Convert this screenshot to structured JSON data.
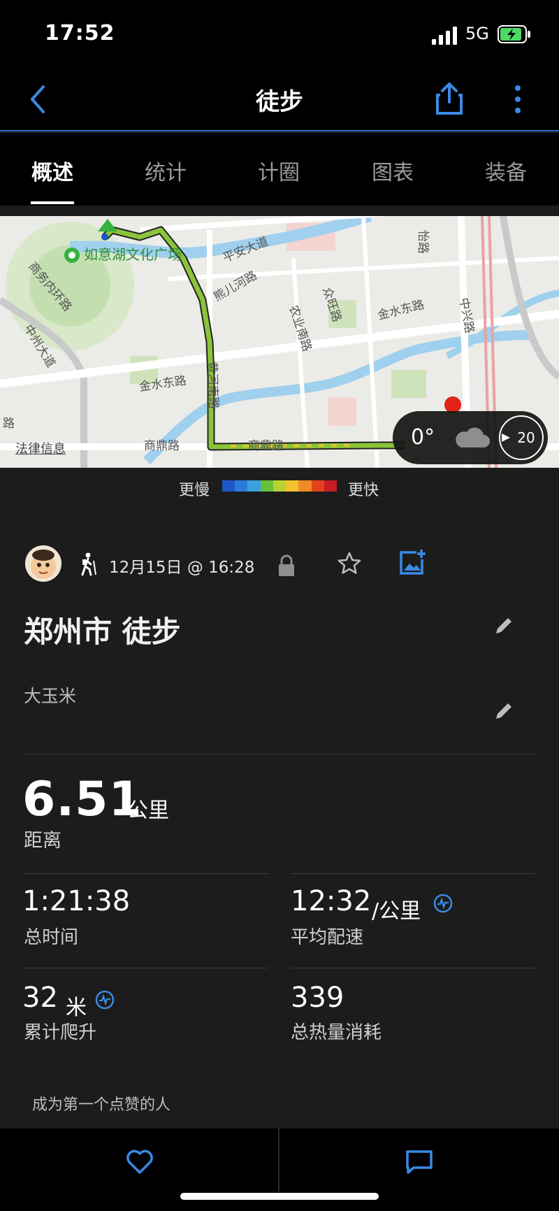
{
  "status": {
    "time": "17:52",
    "network": "5G",
    "battery_color": "#4cd964"
  },
  "nav": {
    "title": "徒步"
  },
  "tabs": [
    {
      "label": "概述",
      "active": true
    },
    {
      "label": "统计"
    },
    {
      "label": "计圈"
    },
    {
      "label": "图表"
    },
    {
      "label": "装备"
    }
  ],
  "map": {
    "legal": "法律信息",
    "labels": [
      "如意湖文化广场",
      "平安大道",
      "熊儿河路",
      "众旺路",
      "农业南路",
      "金水东路",
      "黄河南路",
      "商鼎路",
      "中州大道",
      "商务内环路",
      "中兴路",
      "金水东路",
      "怡路",
      "路",
      "商鼎路"
    ],
    "weather": {
      "temp": "0°",
      "wind": "20"
    }
  },
  "legend": {
    "slow": "更慢",
    "fast": "更快",
    "colors": [
      "#1e56c9",
      "#2a7ad6",
      "#3aa0e0",
      "#67c23a",
      "#b5d230",
      "#f2c12e",
      "#f08a24",
      "#e2431e",
      "#c81d25"
    ]
  },
  "activity": {
    "date": "12月15日 @ 16:28",
    "title": "郑州市 徒步",
    "owner": "大玉米"
  },
  "stats": {
    "distance": {
      "value": "6.51",
      "unit": "公里",
      "label": "距离"
    },
    "total_time": {
      "value": "1:21:38",
      "label": "总时间"
    },
    "avg_pace": {
      "value": "12:32",
      "unit": "/公里",
      "label": "平均配速"
    },
    "elevation": {
      "value": "32",
      "unit": "米",
      "label": "累计爬升"
    },
    "calories": {
      "value": "339",
      "label": "总热量消耗"
    }
  },
  "social": {
    "kudos": "成为第一个点赞的人"
  },
  "colors": {
    "accent": "#3b8ae6",
    "background": "#1c1c1c"
  }
}
